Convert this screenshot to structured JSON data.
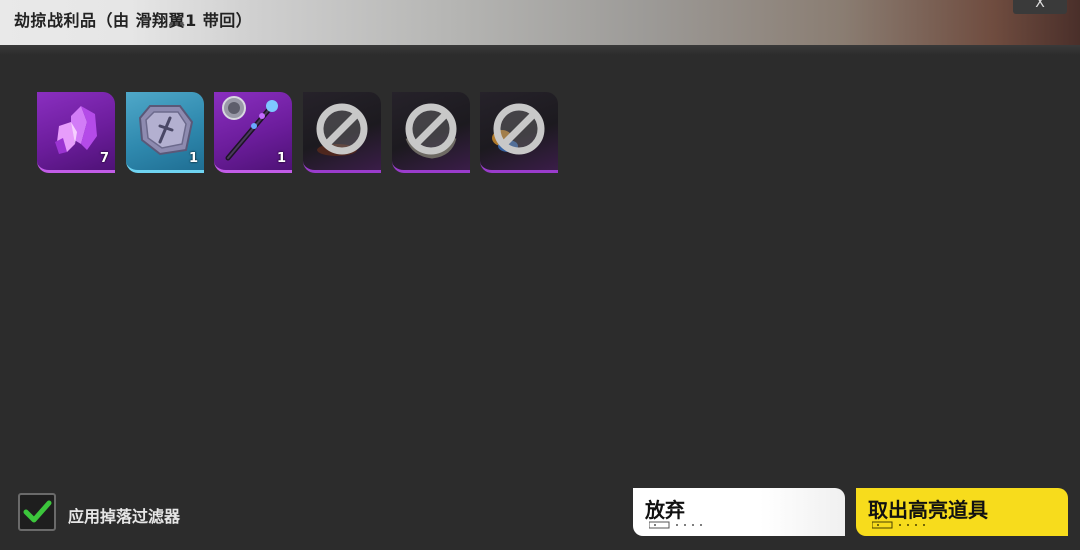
{
  "header": {
    "title": "劫掠战利品（由 滑翔翼1 带回）",
    "close_label": "X"
  },
  "loot": {
    "items": [
      {
        "icon": "purple-crystal-icon",
        "rarity": "purple",
        "count": "7",
        "locked": false
      },
      {
        "icon": "engraved-plate-icon",
        "rarity": "blue",
        "count": "1",
        "locked": false
      },
      {
        "icon": "scepter-staff-icon",
        "rarity": "purple",
        "count": "1",
        "locked": false
      },
      {
        "icon": "prohibited-icon",
        "rarity": "purple",
        "count": "",
        "locked": true
      },
      {
        "icon": "prohibited-icon",
        "rarity": "purple",
        "count": "",
        "locked": true
      },
      {
        "icon": "prohibited-icon",
        "rarity": "purple",
        "count": "",
        "locked": true
      }
    ]
  },
  "footer": {
    "filter_label": "应用掉落过滤器",
    "filter_checked": true,
    "discard_label": "放弃",
    "take_label": "取出高亮道具"
  },
  "colors": {
    "rarity_purple": "#8a2fc0",
    "rarity_blue": "#2f89ae",
    "accent_yellow": "#f7dc1c",
    "check_green": "#3cc63c"
  }
}
